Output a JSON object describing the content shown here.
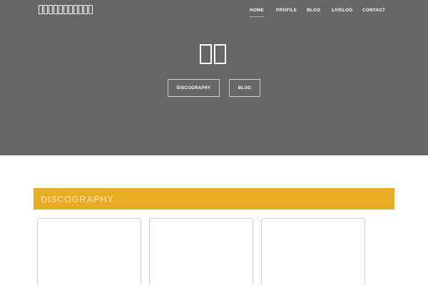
{
  "header": {
    "site_title": "□□□□□□□□□□□",
    "nav": [
      {
        "label": "HOME",
        "active": true
      },
      {
        "label": "PROFILE",
        "active": false
      },
      {
        "label": "BLOG",
        "active": false
      },
      {
        "label": "LIVELOG",
        "active": false
      },
      {
        "label": "CONTACT",
        "active": false
      }
    ]
  },
  "hero": {
    "title": "□□",
    "buttons": [
      "DISCOGRAPHY",
      "BLOG"
    ]
  },
  "discography": {
    "heading": "DISCOGRAPHY",
    "cards": [
      "",
      "",
      ""
    ]
  },
  "colors": {
    "hero_background": "#666666",
    "accent": "#e8ac22",
    "heading_text": "#f4d48a",
    "nav_text": "#ffffff",
    "page_background": "#ffffff"
  }
}
